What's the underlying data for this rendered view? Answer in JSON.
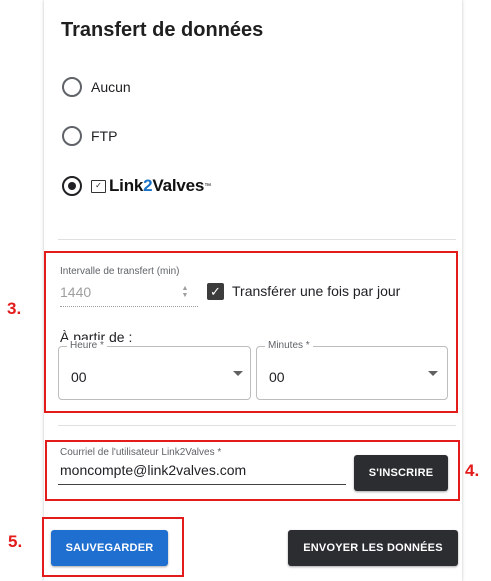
{
  "section": {
    "title": "Transfert de données"
  },
  "transfer_options": [
    {
      "label": "Aucun",
      "selected": false
    },
    {
      "label": "FTP",
      "selected": false
    },
    {
      "label": "Link2Valves",
      "selected": true
    }
  ],
  "logo": {
    "part1": "Link",
    "part2": "2",
    "part3": "Valves",
    "tm": "™"
  },
  "interval": {
    "label": "Intervalle de transfert (min)",
    "value": "1440",
    "once_per_day_label": "Transférer une fois par jour",
    "once_per_day_checked": true
  },
  "start_time": {
    "label": "À partir de :",
    "hour_label": "Heure *",
    "hour_value": "00",
    "minutes_label": "Minutes *",
    "minutes_value": "00"
  },
  "account": {
    "email_label": "Courriel de l'utilisateur Link2Valves *",
    "email_value": "moncompte@link2valves.com",
    "register_button": "S'INSCRIRE"
  },
  "actions": {
    "save_button": "SAUVEGARDER",
    "send_button": "ENVOYER LES DONNÉES"
  },
  "annotations": {
    "step3": "3.",
    "step4": "4.",
    "step5": "5."
  },
  "colors": {
    "annotation_red": "#e31b1b",
    "primary_blue": "#1f6fd0",
    "dark_button": "#2b2d31"
  }
}
